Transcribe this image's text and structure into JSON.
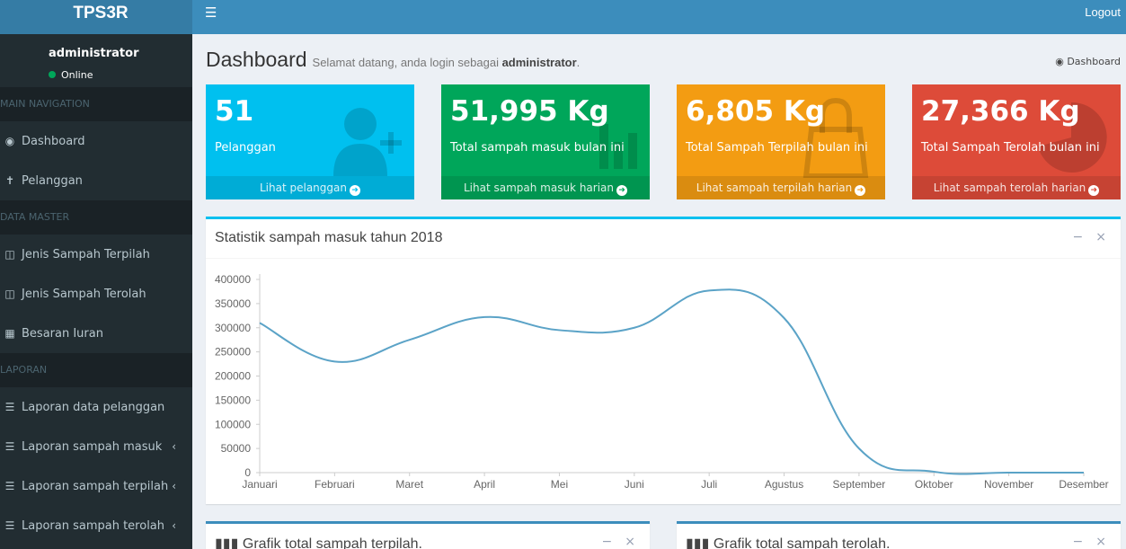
{
  "app": {
    "title": "TPS3R"
  },
  "topbar": {
    "menu_icon": "hamburger-icon",
    "logout": "Logout"
  },
  "user": {
    "name": "administrator",
    "status": "Online",
    "status_color": "#00a65a"
  },
  "sidebar": {
    "sections": [
      {
        "header": "MAIN NAVIGATION",
        "items": [
          {
            "icon": "dashboard-icon",
            "label": "Dashboard"
          },
          {
            "icon": "person-icon",
            "label": "Pelanggan"
          }
        ]
      },
      {
        "header": "DATA MASTER",
        "items": [
          {
            "icon": "trash-icon",
            "label": "Jenis Sampah Terpilah"
          },
          {
            "icon": "trash-icon",
            "label": "Jenis Sampah Terolah"
          },
          {
            "icon": "calculator-icon",
            "label": "Besaran Iuran"
          }
        ]
      },
      {
        "header": "LAPORAN",
        "items": [
          {
            "icon": "list-icon",
            "label": "Laporan data pelanggan"
          },
          {
            "icon": "list-icon",
            "label": "Laporan sampah masuk",
            "chevron": "‹"
          },
          {
            "icon": "list-icon",
            "label": "Laporan sampah terpilah",
            "chevron": "‹"
          },
          {
            "icon": "list-icon",
            "label": "Laporan sampah terolah",
            "chevron": "‹"
          }
        ]
      }
    ]
  },
  "header": {
    "title": "Dashboard",
    "subtitle_prefix": "Selamat datang, anda login sebagai ",
    "subtitle_user": "administrator",
    "subtitle_suffix": ".",
    "breadcrumb": "Dashboard"
  },
  "stat_boxes": [
    {
      "value": "51",
      "label": "Pelanggan",
      "link": "Lihat pelanggan",
      "color": "#00c0ef",
      "icon": "user-add-icon"
    },
    {
      "value": "51,995 Kg",
      "label": "Total sampah masuk bulan ini",
      "link": "Lihat sampah masuk harian",
      "color": "#00a65a",
      "icon": "bar-chart-icon"
    },
    {
      "value": "6,805 Kg",
      "label": "Total Sampah Terpilah bulan ini",
      "link": "Lihat sampah terpilah harian",
      "color": "#f39c12",
      "icon": "shopping-bag-icon"
    },
    {
      "value": "27,366 Kg",
      "label": "Total Sampah Terolah bulan ini",
      "link": "Lihat sampah terolah harian",
      "color": "#dd4b39",
      "icon": "pie-chart-icon"
    }
  ],
  "chart_panel": {
    "title": "Statistik sampah masuk tahun 2018",
    "minimize": "−",
    "close": "×"
  },
  "chart_data": {
    "type": "line",
    "title": "",
    "categories": [
      "Januari",
      "Februari",
      "Maret",
      "April",
      "Mei",
      "Juni",
      "Juli",
      "Agustus",
      "September",
      "Oktober",
      "November",
      "Desember"
    ],
    "series": [
      {
        "values": [
          310000,
          230000,
          275000,
          322000,
          295000,
          300000,
          377000,
          320000,
          50000,
          2000,
          0,
          0
        ],
        "color": "#5ba3c7"
      }
    ],
    "ylim": [
      0,
      400000
    ],
    "yticks": [
      0,
      50000,
      100000,
      150000,
      200000,
      250000,
      300000,
      350000,
      400000
    ],
    "grid": false
  },
  "bottom_panels": [
    {
      "title": "Grafik total sampah terpilah.",
      "icon": "bar-chart-icon",
      "minimize": "−",
      "close": "×"
    },
    {
      "title": "Grafik total sampah terolah.",
      "icon": "bar-chart-icon",
      "minimize": "−",
      "close": "×"
    }
  ]
}
